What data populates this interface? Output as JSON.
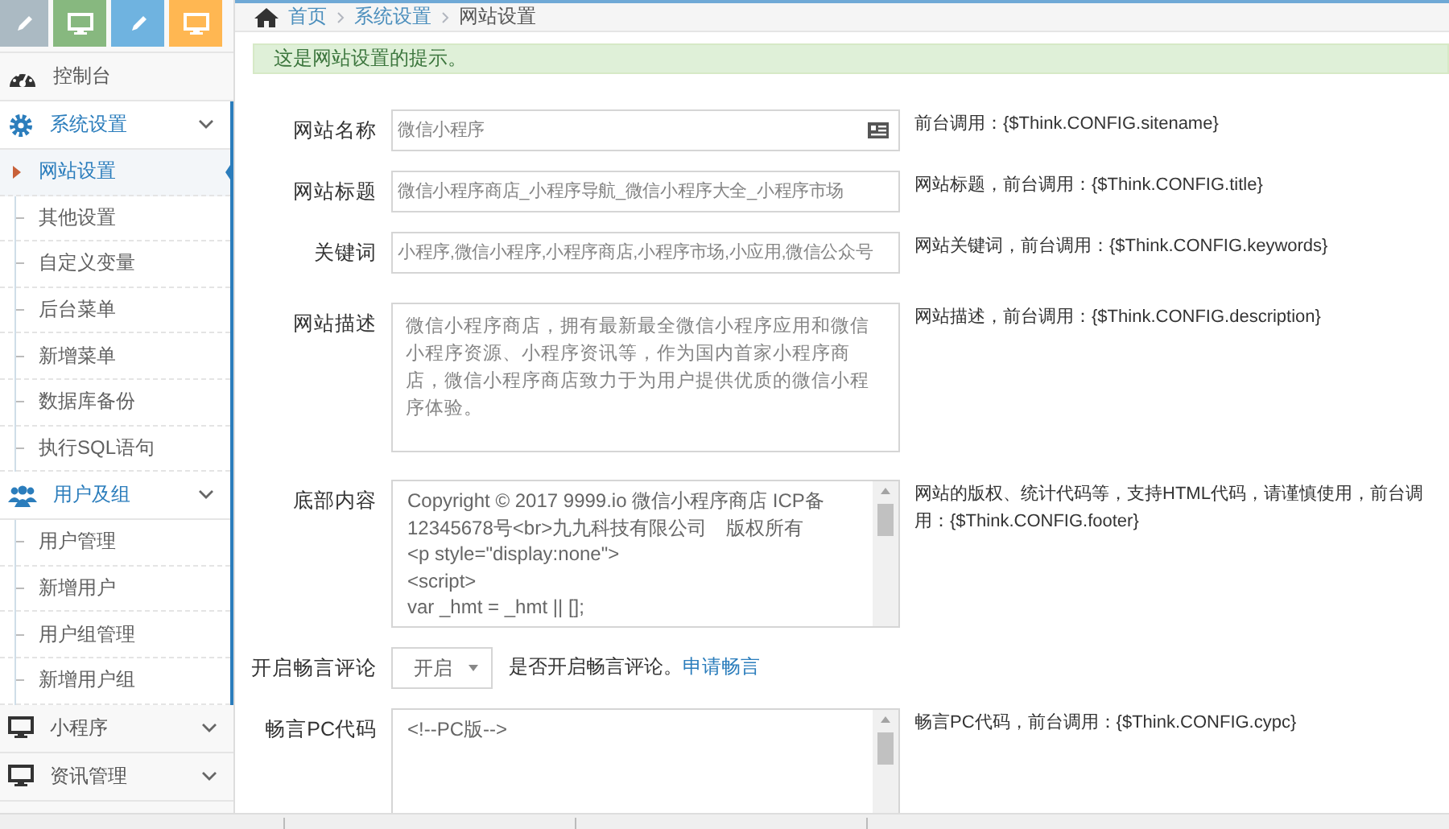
{
  "shortcuts": [
    {
      "kind": "pencil",
      "color": "#abbac3"
    },
    {
      "kind": "monitor",
      "color": "#87b87f"
    },
    {
      "kind": "pencil",
      "color": "#6fb3e0"
    },
    {
      "kind": "monitor",
      "color": "#ffb752"
    }
  ],
  "sidebar": {
    "items": [
      {
        "label": "控制台",
        "kind": "dashboard",
        "expanded": false
      },
      {
        "label": "系统设置",
        "kind": "settings",
        "expanded": true,
        "children": [
          {
            "label": "网站设置",
            "selected": true
          },
          {
            "label": "其他设置",
            "selected": false
          },
          {
            "label": "自定义变量",
            "selected": false
          },
          {
            "label": "后台菜单",
            "selected": false
          },
          {
            "label": "新增菜单",
            "selected": false
          },
          {
            "label": "数据库备份",
            "selected": false
          },
          {
            "label": "执行SQL语句",
            "selected": false
          }
        ]
      },
      {
        "label": "用户及组",
        "kind": "users",
        "expanded": true,
        "children": [
          {
            "label": "用户管理",
            "selected": false
          },
          {
            "label": "新增用户",
            "selected": false
          },
          {
            "label": "用户组管理",
            "selected": false
          },
          {
            "label": "新增用户组",
            "selected": false
          }
        ]
      },
      {
        "label": "小程序",
        "kind": "monitor_group",
        "expanded": false
      },
      {
        "label": "资讯管理",
        "kind": "monitor_group",
        "expanded": false
      }
    ]
  },
  "breadcrumb": [
    "首页",
    "系统设置",
    "网站设置"
  ],
  "alert": "这是网站设置的提示。",
  "form": {
    "rows": [
      {
        "kind": "input_addon",
        "label": "网站名称",
        "value": "微信小程序",
        "help": "前台调用：{$Think.CONFIG.sitename}"
      },
      {
        "kind": "input",
        "label": "网站标题",
        "value": "微信小程序商店_小程序导航_微信小程序大全_小程序市场",
        "help": "网站标题，前台调用：{$Think.CONFIG.title}"
      },
      {
        "kind": "input",
        "label": "关键词",
        "value": "小程序,微信小程序,小程序商店,小程序市场,小应用,微信公众号",
        "help": "网站关键词，前台调用：{$Think.CONFIG.keywords}"
      },
      {
        "kind": "textarea",
        "label": "网站描述",
        "lines": [
          "微信小程序商店，拥有最新最全微信小程序应用和微信小程序资源、小程序资讯等，作为国内首家小程序商店，微信小程序商店致力于为用户提供优质的微信小程序体验。"
        ],
        "help": "网站描述，前台调用：{$Think.CONFIG.description}"
      },
      {
        "kind": "code",
        "label": "底部内容",
        "lines": [
          "Copyright © 2017 9999.io 微信小程序商店 ICP备",
          "12345678号<br>九九科技有限公司　版权所有",
          "<p style=\"display:none\">",
          "<script>",
          "var _hmt = _hmt || [];"
        ],
        "help": "网站的版权、统计代码等，支持HTML代码，请谨慎使用，前台调用：{$Think.CONFIG.footer}"
      },
      {
        "kind": "select",
        "label": "开启畅言评论",
        "value": "开启",
        "note": "是否开启畅言评论。",
        "link": "申请畅言"
      },
      {
        "kind": "code",
        "label": "畅言PC代码",
        "lines": [
          "<!--PC版-->"
        ],
        "help": "畅言PC代码，前台调用：{$Think.CONFIG.cypc}"
      }
    ]
  }
}
